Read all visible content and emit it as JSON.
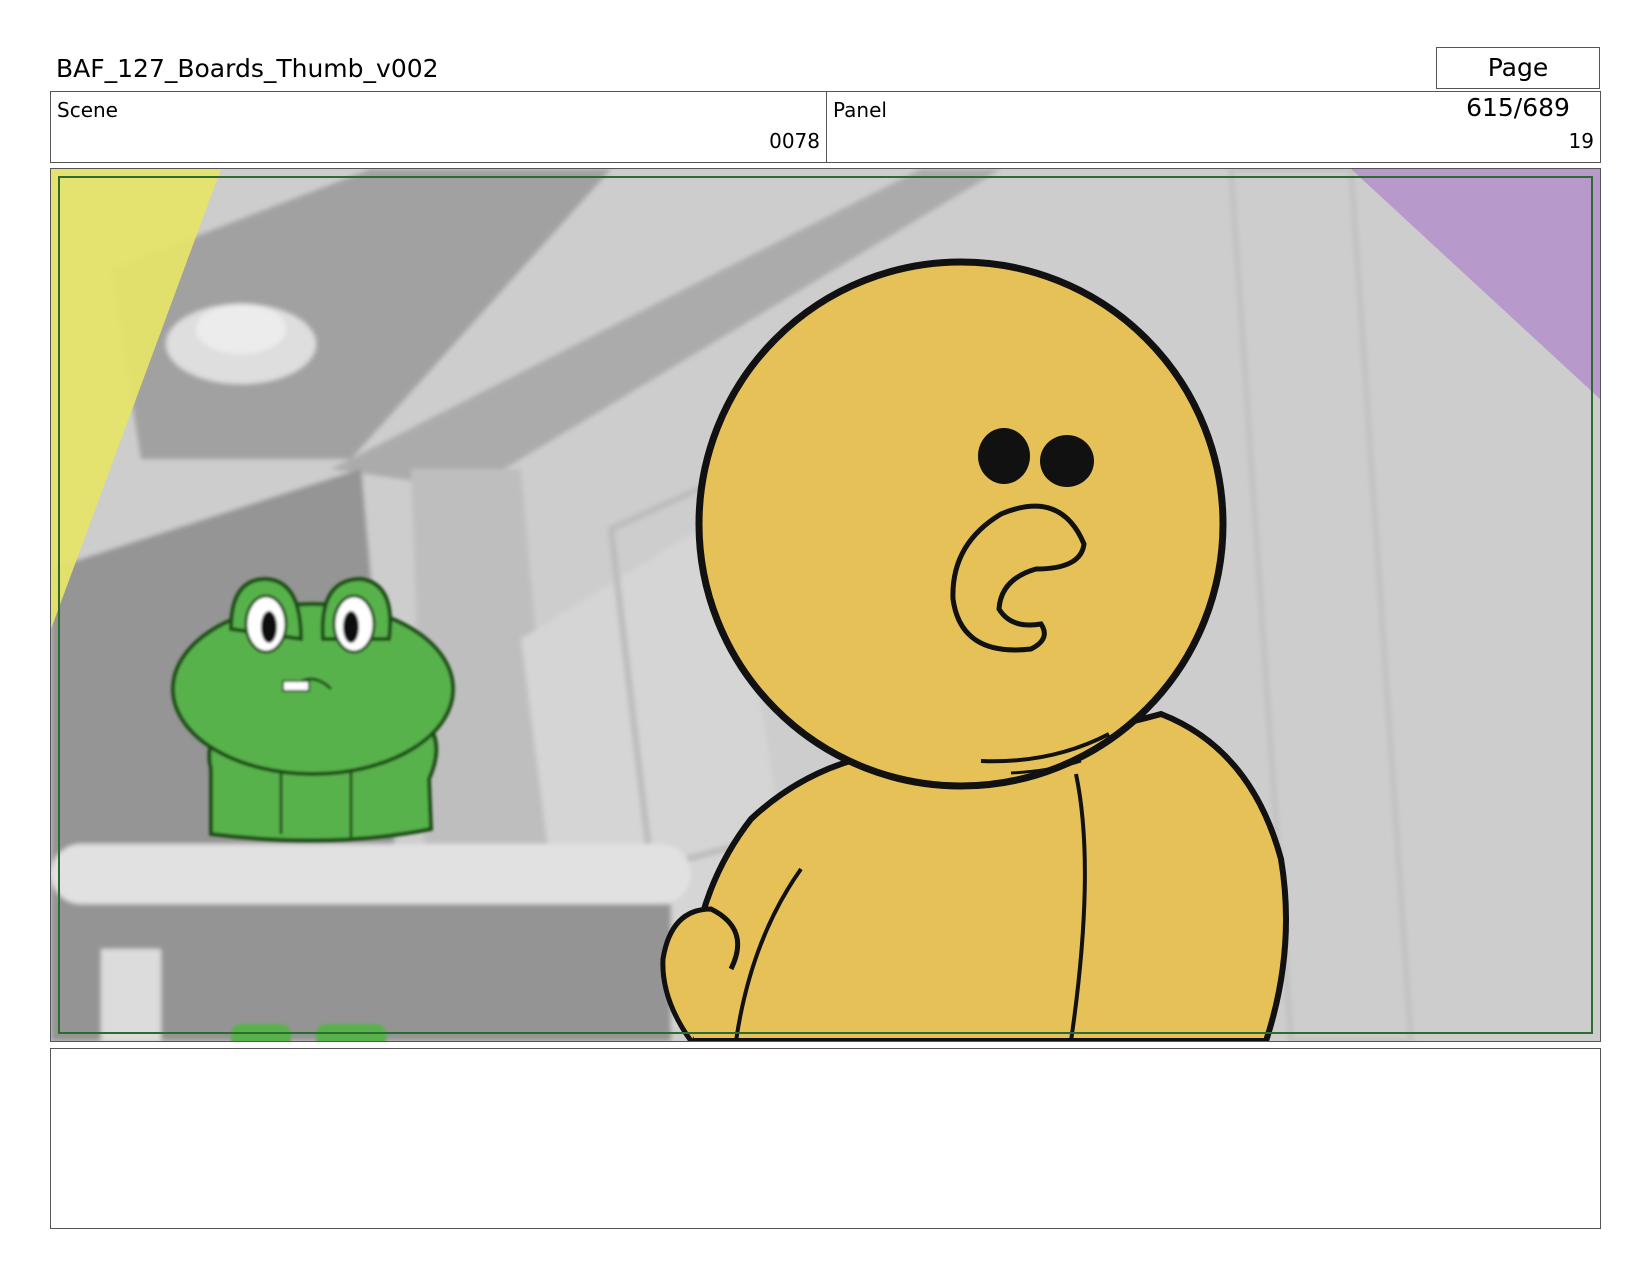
{
  "header": {
    "document_title": "BAF_127_Boards_Thumb_v002",
    "page_label": "Page 615/689"
  },
  "info": {
    "scene_label": "Scene",
    "scene_value": "0078",
    "panel_label": "Panel",
    "panel_value": "19"
  },
  "illustration": {
    "description_icon": "storyboard-frame",
    "colors": {
      "background_gray": "#cdcdcd",
      "yellow_corner": "#e6e46a",
      "purple_corner": "#b899cb",
      "frog_green": "#59b24c",
      "chick_yellow": "#e6c158",
      "safe_frame": "#2e6b2e"
    }
  },
  "notes": {
    "text": ""
  }
}
